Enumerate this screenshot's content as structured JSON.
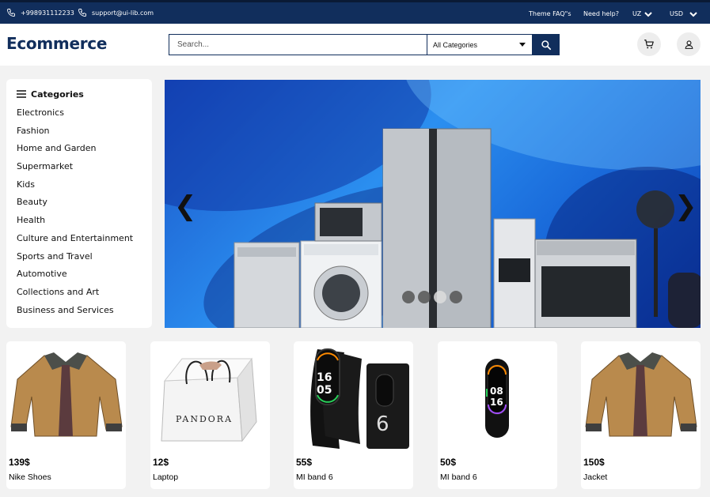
{
  "topbar": {
    "phone": "+998931112233",
    "email": "support@ui-lib.com",
    "faq": "Theme FAQ\"s",
    "help": "Need help?",
    "language": "UZ",
    "currency": "USD"
  },
  "header": {
    "logo": "Ecommerce",
    "search_placeholder": "Search...",
    "category_selected": "All Categories"
  },
  "sidebar": {
    "title": "Categories",
    "items": [
      "Electronics",
      "Fashion",
      "Home and Garden",
      "Supermarket",
      "Kids",
      "Beauty",
      "Health",
      "Culture and Entertainment",
      "Sports and Travel",
      "Automotive",
      "Collections and Art",
      "Business and Services"
    ]
  },
  "banner": {
    "prev": "❮",
    "next": "❯",
    "slide_count": 4,
    "active_slide": 3
  },
  "products": [
    {
      "price": "139$",
      "name": "Nike Shoes",
      "image": "jacket"
    },
    {
      "price": "12$",
      "name": "Laptop",
      "image": "pandora-bag"
    },
    {
      "price": "55$",
      "name": "MI band 6",
      "image": "mi-band-box"
    },
    {
      "price": "50$",
      "name": "MI band 6",
      "image": "mi-band"
    },
    {
      "price": "150$",
      "name": "Jacket",
      "image": "jacket"
    }
  ],
  "product_image_text": {
    "bag_brand": "PANDORA",
    "band_hour": "16",
    "band_minute": "05",
    "band_time_top": "08",
    "band_time_bottom": "16",
    "box_number": "6"
  },
  "colors": {
    "navy": "#112e5c",
    "banner_blue": "#1a6be0"
  }
}
